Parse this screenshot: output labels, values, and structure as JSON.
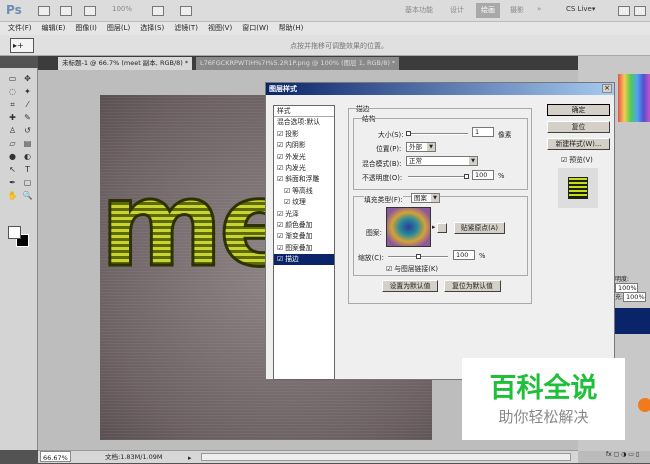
{
  "app": {
    "logo": "Ps",
    "zoom_level": "100%",
    "workspaces": [
      "基本功能",
      "设计",
      "绘画",
      "摄影"
    ],
    "active_workspace": "绘画",
    "more": "»",
    "cs_live": "CS Live▾"
  },
  "menu": [
    "文件(F)",
    "编辑(E)",
    "图像(I)",
    "图层(L)",
    "选择(S)",
    "滤镜(T)",
    "视图(V)",
    "窗口(W)",
    "帮助(H)"
  ],
  "options": {
    "hint": "点按并拖移可调整效果的位置。",
    "tool": "▸+"
  },
  "tabs": [
    {
      "label": "未标题-1 @ 66.7% (meet 副本, RGB/8) *",
      "active": true
    },
    {
      "label": "L76FGCKRPWTIH%7I%5.2R1P.png @ 100% (图层 1, RGB/8) *",
      "active": false
    }
  ],
  "canvas": {
    "text": "me"
  },
  "status": {
    "zoom": "66.67%",
    "doc": "文档:1.83M/1.09M"
  },
  "dialog": {
    "title": "图层样式",
    "styles_header": "样式",
    "blend_default": "混合选项:默认",
    "items": [
      {
        "label": "投影",
        "checked": true
      },
      {
        "label": "内阴影",
        "checked": true
      },
      {
        "label": "外发光",
        "checked": true
      },
      {
        "label": "内发光",
        "checked": true
      },
      {
        "label": "斜面和浮雕",
        "checked": true
      },
      {
        "label": "等高线",
        "checked": true,
        "sub": true
      },
      {
        "label": "纹理",
        "checked": true,
        "sub": true
      },
      {
        "label": "光泽",
        "checked": true
      },
      {
        "label": "颜色叠加",
        "checked": true
      },
      {
        "label": "渐变叠加",
        "checked": true
      },
      {
        "label": "图案叠加",
        "checked": true
      },
      {
        "label": "描边",
        "checked": true,
        "selected": true
      }
    ],
    "section": "描边",
    "structure": "结构",
    "size_label": "大小(S):",
    "size_value": "1",
    "size_unit": "像素",
    "position_label": "位置(P):",
    "position_value": "外部",
    "blend_label": "混合模式(B):",
    "blend_value": "正常",
    "opacity_label": "不透明度(O):",
    "opacity_value": "100",
    "opacity_unit": "%",
    "fill_label": "填充类型(F):",
    "fill_value": "图案",
    "pattern_label": "图案:",
    "snap_button": "贴紧原点(A)",
    "scale_label": "缩放(C):",
    "scale_value": "100",
    "scale_unit": "%",
    "link_label": "与图层链接(K)",
    "link_checked": true,
    "set_default": "设置为默认值",
    "reset_default": "复位为默认值",
    "ok": "确定",
    "reset": "复位",
    "new_style": "新建样式(W)...",
    "preview_label": "预览(V)",
    "preview_checked": true
  },
  "panels": {
    "opacity_label": "明度:",
    "opacity_value": "100%",
    "fill_label": "充:",
    "fill_value": "100%"
  },
  "watermark": {
    "title": "百科全说",
    "subtitle": "助你轻松解决"
  }
}
